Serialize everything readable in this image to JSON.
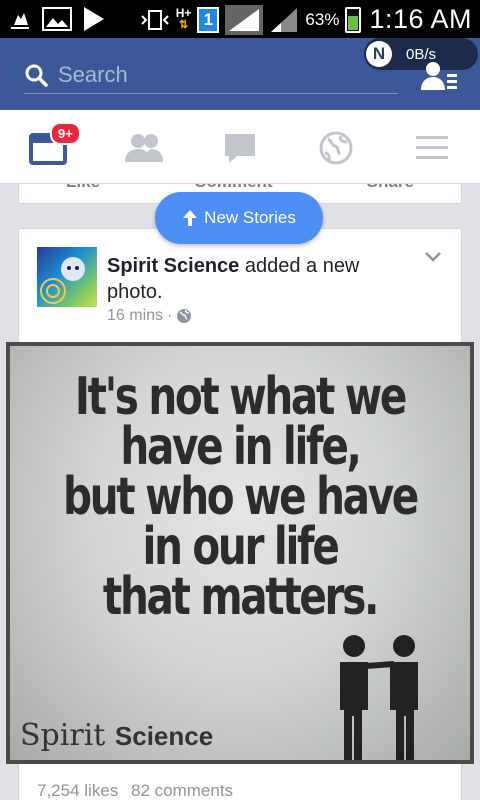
{
  "status_bar": {
    "sim": "1",
    "network": "H+",
    "battery": "63%",
    "time": "1:16 AM"
  },
  "header": {
    "search_placeholder": "Search",
    "speed_icon_letter": "N",
    "speed": "0B/s"
  },
  "tabs": {
    "notification_badge": "9+"
  },
  "prev_post": {
    "like": "Like",
    "comment": "Comment",
    "share": "Share"
  },
  "new_stories": "New Stories",
  "post": {
    "author": "Spirit Science",
    "action": " added a new photo.",
    "time": "16 mins",
    "image": {
      "lines": [
        "It's not what we",
        "have in life,",
        "but who we have",
        "in our life",
        "that matters."
      ],
      "brand_a": "Spirit",
      "brand_b": "Science"
    },
    "likes": "7,254 likes",
    "comments": "82 comments"
  },
  "colors": {
    "facebook_blue": "#3b5998",
    "pill_blue": "#4d8ff5",
    "badge_red": "#e8283a"
  }
}
